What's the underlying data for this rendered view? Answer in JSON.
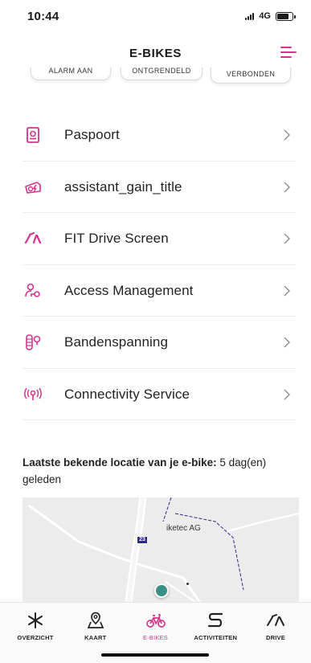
{
  "status_bar": {
    "time": "10:44",
    "network": "4G",
    "battery_level": 0.75
  },
  "header": {
    "title": "E-BIKES"
  },
  "status_pills": [
    "ALARM AAN",
    "ONTGRENDELD",
    "VERBONDEN"
  ],
  "menu": [
    {
      "label": "Paspoort",
      "icon": "passport-icon"
    },
    {
      "label": "assistant_gain_title",
      "icon": "bike-battery-icon"
    },
    {
      "label": "FIT Drive Screen",
      "icon": "gauge-icon"
    },
    {
      "label": "Access Management",
      "icon": "key-user-icon"
    },
    {
      "label": "Bandenspanning",
      "icon": "tire-pressure-icon"
    },
    {
      "label": "Connectivity Service",
      "icon": "antenna-icon"
    }
  ],
  "location": {
    "label": "Laatste bekende locatie van je e-bike:",
    "value": "5 dag(en) geleden"
  },
  "map": {
    "road_badge": "23",
    "place_label": "iketec AG"
  },
  "bottom_nav": [
    {
      "label": "OVERZICHT",
      "icon": "overview-icon",
      "active": false
    },
    {
      "label": "KAART",
      "icon": "map-pin-icon",
      "active": false
    },
    {
      "label": "E-BIKES",
      "icon": "bike-icon",
      "active": true
    },
    {
      "label": "ACTIVITEITEN",
      "icon": "route-icon",
      "active": false
    },
    {
      "label": "DRIVE",
      "icon": "speedometer-icon",
      "active": false
    }
  ],
  "colors": {
    "accent": "#d6338c",
    "text": "#222222",
    "map_route": "#2a2a8c",
    "location_dot": "#3a8f86"
  }
}
